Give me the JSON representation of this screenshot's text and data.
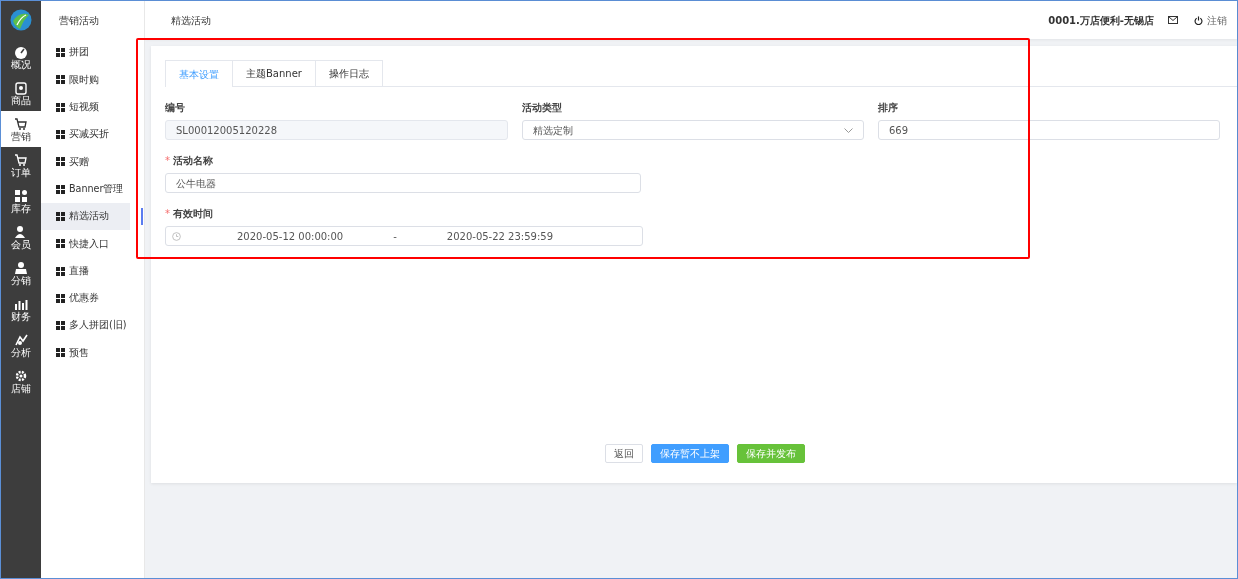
{
  "rail": [
    {
      "label": "概况",
      "selected": false
    },
    {
      "label": "商品",
      "selected": false
    },
    {
      "label": "营销",
      "selected": true
    },
    {
      "label": "订单",
      "selected": false
    },
    {
      "label": "库存",
      "selected": false
    },
    {
      "label": "会员",
      "selected": false
    },
    {
      "label": "分销",
      "selected": false
    },
    {
      "label": "财务",
      "selected": false
    },
    {
      "label": "分析",
      "selected": false
    },
    {
      "label": "店铺",
      "selected": false
    }
  ],
  "submenu": {
    "title": "营销活动",
    "items": [
      {
        "label": "拼团",
        "selected": false
      },
      {
        "label": "限时购",
        "selected": false
      },
      {
        "label": "短视频",
        "selected": false
      },
      {
        "label": "买减买折",
        "selected": false
      },
      {
        "label": "买赠",
        "selected": false
      },
      {
        "label": "Banner管理",
        "selected": false
      },
      {
        "label": "精选活动",
        "selected": true
      },
      {
        "label": "快捷入口",
        "selected": false
      },
      {
        "label": "直播",
        "selected": false
      },
      {
        "label": "优惠券",
        "selected": false
      },
      {
        "label": "多人拼团(旧)",
        "selected": false
      },
      {
        "label": "预售",
        "selected": false
      }
    ]
  },
  "header": {
    "title": "精选活动",
    "store": "0001.万店便利-无锡店",
    "logout": "注销"
  },
  "tabs": [
    {
      "label": "基本设置",
      "selected": true
    },
    {
      "label": "主题Banner",
      "selected": false
    },
    {
      "label": "操作日志",
      "selected": false
    }
  ],
  "form": {
    "code": {
      "label": "编号",
      "value": "SL00012005120228",
      "disabled": true
    },
    "type": {
      "label": "活动类型",
      "value": "精选定制"
    },
    "sort": {
      "label": "排序",
      "value": "669"
    },
    "name": {
      "label": "活动名称",
      "required_mark": "*",
      "value": "公牛电器"
    },
    "period": {
      "label": "有效时间",
      "required_mark": "*",
      "start": "2020-05-12 00:00:00",
      "separator": "-",
      "end": "2020-05-22 23:59:59"
    }
  },
  "buttons": [
    {
      "label": "返回",
      "kind": "default"
    },
    {
      "label": "保存暂不上架",
      "kind": "primary"
    },
    {
      "label": "保存并发布",
      "kind": "success"
    }
  ],
  "annotation": {
    "kind": "highlight"
  }
}
